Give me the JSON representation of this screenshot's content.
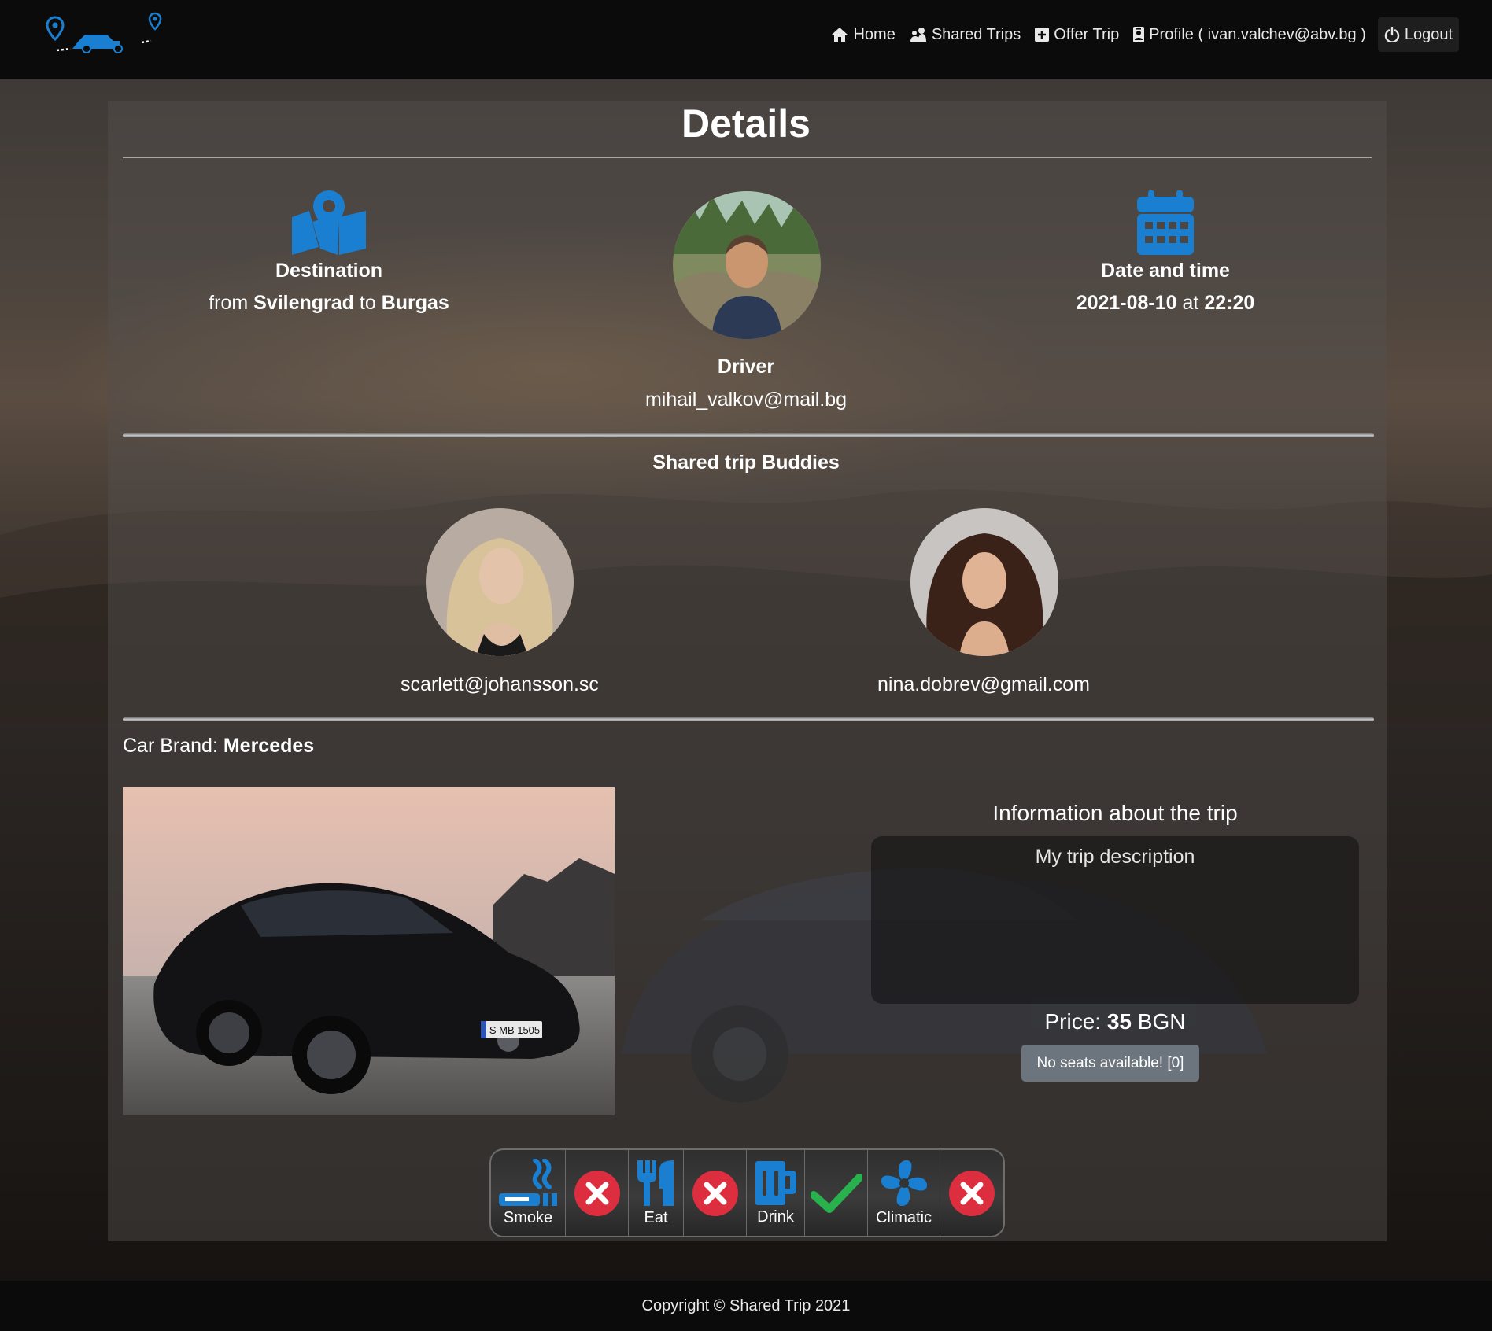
{
  "nav": {
    "home": "Home",
    "shared_trips": "Shared Trips",
    "offer_trip": "Offer Trip",
    "profile": "Profile ( ivan.valchev@abv.bg )",
    "logout": "Logout"
  },
  "page": {
    "title": "Details"
  },
  "destination": {
    "heading": "Destination",
    "from_word": "from",
    "from": "Svilengrad",
    "to_word": "to",
    "to": "Burgas"
  },
  "datetime": {
    "heading": "Date and time",
    "date": "2021-08-10",
    "at_word": "at",
    "time": "22:20"
  },
  "driver": {
    "label": "Driver",
    "email": "mihail_valkov@mail.bg"
  },
  "buddies": {
    "title": "Shared trip Buddies",
    "items": [
      {
        "email": "scarlett@johansson.sc"
      },
      {
        "email": "nina.dobrev@gmail.com"
      }
    ]
  },
  "car": {
    "brand_label": "Car Brand:",
    "brand": "Mercedes",
    "plate": "S MB 1505"
  },
  "trip_info": {
    "title": "Information about the trip",
    "description": "My trip description",
    "price_label": "Price:",
    "price_value": "35",
    "currency": "BGN",
    "seats_button": "No seats available! [0]"
  },
  "amenities": [
    {
      "label": "Smoke",
      "icon": "smoking-icon",
      "allowed": false
    },
    {
      "label": "Eat",
      "icon": "utensils-icon",
      "allowed": false
    },
    {
      "label": "Drink",
      "icon": "beer-mug-icon",
      "allowed": true
    },
    {
      "label": "Climatic",
      "icon": "fan-icon",
      "allowed": false
    }
  ],
  "colors": {
    "accent_blue": "#1a7fd0",
    "deny_red": "#dc2e3e",
    "allow_green": "#28b14c",
    "button_gray": "#6c757d"
  },
  "footer": {
    "text": "Copyright © Shared Trip 2021"
  }
}
